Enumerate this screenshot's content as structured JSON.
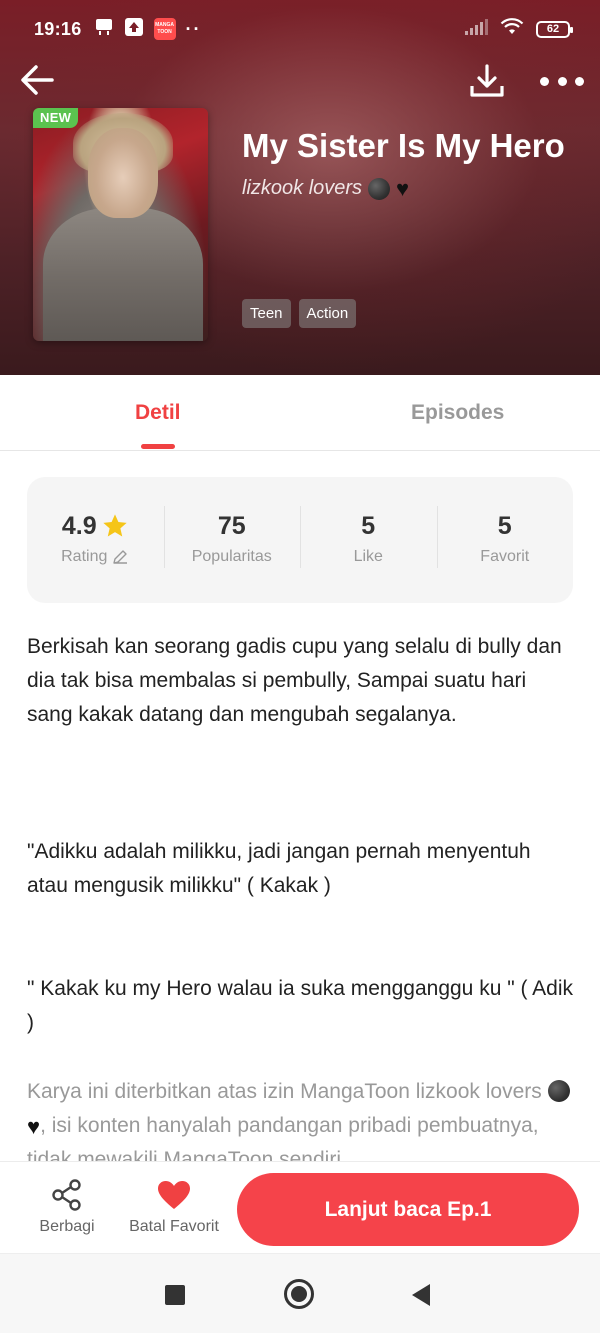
{
  "status_bar": {
    "time": "19:16",
    "app_badge_text": "MANGA TOON",
    "dots": "··",
    "battery": "62"
  },
  "header": {
    "new_badge": "NEW",
    "title": "My Sister Is My Hero",
    "author": "lizkook lovers",
    "tags": [
      "Teen",
      "Action"
    ]
  },
  "tabs": {
    "detail": "Detil",
    "episodes": "Episodes"
  },
  "stats": {
    "rating_value": "4.9",
    "rating_label": "Rating",
    "popularity_value": "75",
    "popularity_label": "Popularitas",
    "like_value": "5",
    "like_label": "Like",
    "favorite_value": "5",
    "favorite_label": "Favorit"
  },
  "description": {
    "paragraph1": "Berkisah kan seorang gadis cupu yang selalu di bully dan dia tak bisa membalas si pembully, Sampai suatu hari sang kakak datang dan mengubah segalanya.",
    "paragraph2": "\"Adikku adalah milikku, jadi jangan pernah menyentuh atau mengusik milikku\" ( Kakak )",
    "paragraph3": "\" Kakak ku my Hero walau ia suka mengganggu ku \" ( Adik )",
    "disclaimer_before": "Karya ini diterbitkan atas izin MangaToon lizkook lovers",
    "disclaimer_after": ", isi konten hanyalah pandangan pribadi pembuatnya, tidak mewakili MangaToon sendiri."
  },
  "actions": {
    "share_label": "Berbagi",
    "favorite_label": "Batal Favorit",
    "read_button": "Lanjut baca Ep.1"
  },
  "colors": {
    "accent": "#f04142",
    "read_button": "#f5434a",
    "new_badge": "#5bc24f",
    "star": "#f5c518"
  },
  "icons": [
    "back-arrow-icon",
    "download-icon",
    "more-icon",
    "star-icon",
    "edit-icon",
    "share-icon",
    "heart-icon",
    "moon-emoji-icon",
    "black-heart-emoji-icon"
  ]
}
